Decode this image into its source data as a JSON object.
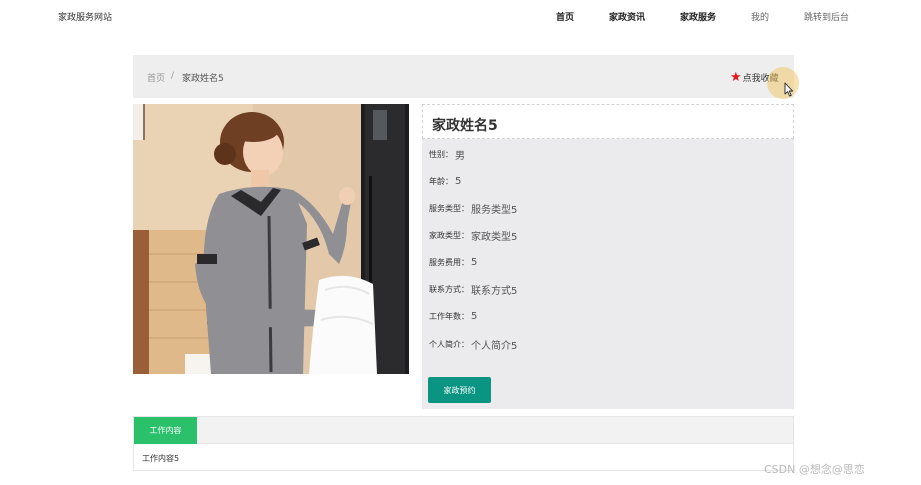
{
  "header": {
    "site_title": "家政服务网站",
    "nav": [
      "首页",
      "家政资讯",
      "家政服务",
      "我的",
      "跳转到后台"
    ]
  },
  "breadcrumb": {
    "home": "首页",
    "separator": "/",
    "current": "家政姓名5"
  },
  "favorite": {
    "label": "点我收藏",
    "icon": "star-icon",
    "color": "#e4161b"
  },
  "detail": {
    "title": "家政姓名5",
    "fields": [
      {
        "label": "性别：",
        "value": "男"
      },
      {
        "label": "年龄：",
        "value": "5"
      },
      {
        "label": "服务类型：",
        "value": "服务类型5"
      },
      {
        "label": "家政类型：",
        "value": "家政类型5"
      },
      {
        "label": "服务费用：",
        "value": "5"
      },
      {
        "label": "联系方式：",
        "value": "联系方式5"
      },
      {
        "label": "工作年数：",
        "value": "5"
      },
      {
        "label": "个人简介：",
        "value": "个人简介5"
      }
    ],
    "book_button": "家政预约"
  },
  "tabs": {
    "active_label": "工作内容",
    "content": "工作内容5"
  },
  "watermark": "CSDN @想念@思恋",
  "colors": {
    "accent_teal": "#0a9482",
    "tab_green": "#2bc06a",
    "star_red": "#e4161b"
  }
}
